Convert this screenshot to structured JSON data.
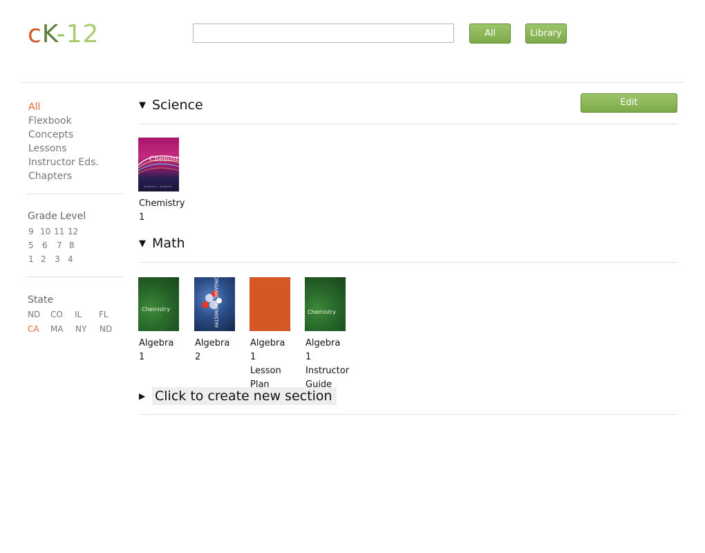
{
  "header": {
    "logo": {
      "c": "c",
      "k": "K",
      "dash": "-",
      "num": "12"
    },
    "search": {
      "value": "",
      "placeholder": ""
    },
    "buttons": {
      "all": "All",
      "library": "Library"
    }
  },
  "sidebar": {
    "filters": [
      "All",
      "Flexbook",
      "Concepts",
      "Lessons",
      "Instructor Eds.",
      "Chapters"
    ],
    "active_filter": "All",
    "grade_level": {
      "heading": "Grade Level",
      "rows": [
        [
          "9",
          "10",
          "11",
          "12"
        ],
        [
          "5",
          "6",
          "7",
          "8"
        ],
        [
          "1",
          "2",
          "3",
          "4"
        ]
      ]
    },
    "state": {
      "heading": "State",
      "rows": [
        [
          "ND",
          "CO",
          "IL",
          "FL"
        ],
        [
          "CA",
          "MA",
          "NY",
          "ND"
        ]
      ],
      "active": "CA"
    }
  },
  "main": {
    "edit_label": "Edit",
    "sections": [
      {
        "title": "Science",
        "books": [
          {
            "title_lines": [
              "Chemistry",
              "1"
            ],
            "cover_text": "Chemistry",
            "cover_subtext": "ZUMDAHL | ZUMDAHL"
          }
        ]
      },
      {
        "title": "Math",
        "books": [
          {
            "title_lines": [
              "Algebra 1"
            ],
            "cover_text": "Chemistry"
          },
          {
            "title_lines": [
              "Algebra",
              "2"
            ],
            "cover_text": "ORGANIC CHEMISTRY"
          },
          {
            "title_lines": [
              "Algebra 1",
              "Lesson",
              "Plan"
            ],
            "cover_text": ""
          },
          {
            "title_lines": [
              "Algebra 1",
              "Instructor",
              "Guide"
            ],
            "cover_text": "Chemistry"
          }
        ]
      }
    ],
    "new_section_label": "Click to create new section"
  },
  "colors": {
    "accent_orange": "#e06a32",
    "button_green": "#8ab957"
  }
}
